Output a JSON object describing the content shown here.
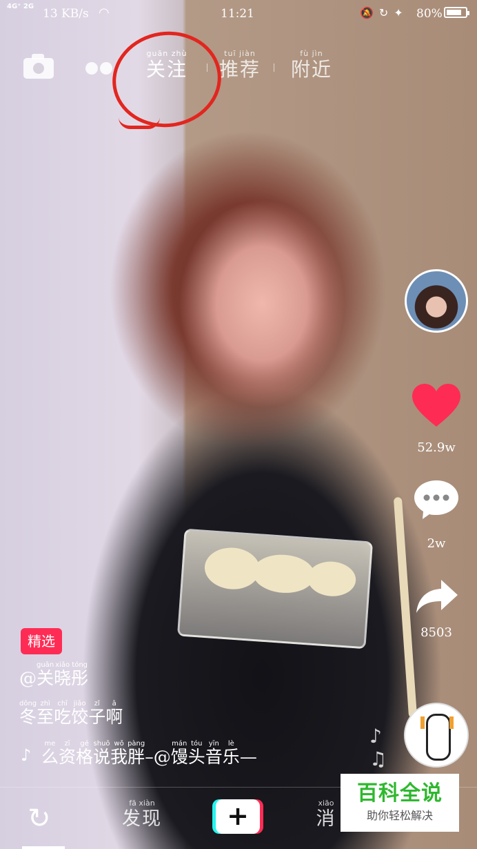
{
  "status_bar": {
    "network": "4G⁺ 2G",
    "speed": "13 KB/s",
    "time": "11:21",
    "battery_pct": "80%",
    "battery_level": 0.8
  },
  "top_nav": {
    "tabs": [
      {
        "pinyin": "guān zhù",
        "label": "关注"
      },
      {
        "pinyin": "tuī jiàn",
        "label": "推荐"
      },
      {
        "pinyin": "fù jìn",
        "label": "附近"
      }
    ]
  },
  "right_rail": {
    "likes": "52.9w",
    "comments": "2w",
    "shares": "8503"
  },
  "caption": {
    "badge": "精选",
    "author": {
      "at": "@",
      "chars": [
        {
          "c": "关",
          "p": "guān"
        },
        {
          "c": "晓",
          "p": "xiǎo"
        },
        {
          "c": "彤",
          "p": "tóng"
        }
      ]
    },
    "text": [
      {
        "c": "冬",
        "p": "dōng"
      },
      {
        "c": "至",
        "p": "zhì"
      },
      {
        "c": "吃",
        "p": "chī"
      },
      {
        "c": "饺",
        "p": "jiǎo"
      },
      {
        "c": "子",
        "p": "zǐ"
      },
      {
        "c": "啊",
        "p": "ā"
      }
    ],
    "music": [
      {
        "c": "么",
        "p": "me"
      },
      {
        "c": "资",
        "p": "zī"
      },
      {
        "c": "格",
        "p": "gé"
      },
      {
        "c": "说",
        "p": "shuō"
      },
      {
        "c": "我",
        "p": "wǒ"
      },
      {
        "c": "胖",
        "p": "pàng"
      },
      {
        "c": "–@",
        "p": ""
      },
      {
        "c": "馒",
        "p": "mán"
      },
      {
        "c": "头",
        "p": "tóu"
      },
      {
        "c": "音",
        "p": "yīn"
      },
      {
        "c": "乐",
        "p": "lè"
      },
      {
        "c": "—",
        "p": ""
      }
    ]
  },
  "bottom_nav": {
    "discover": {
      "pinyin": "fā xiàn",
      "label": "发现"
    },
    "messages": {
      "pinyin": "xiāo",
      "label": "消"
    },
    "add_label": "+"
  },
  "watermark": {
    "title": "百科全说",
    "subtitle": "助你轻松解决"
  }
}
